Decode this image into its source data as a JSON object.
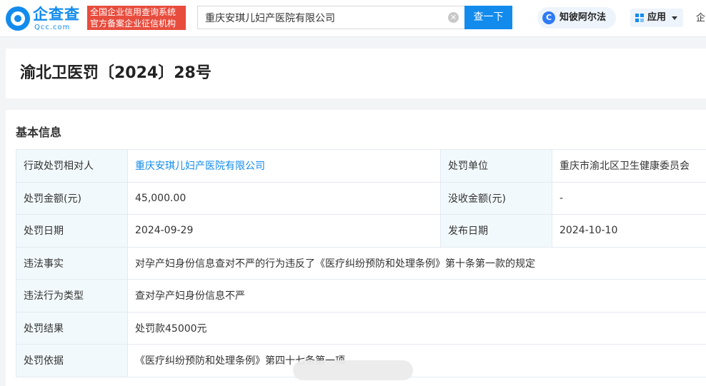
{
  "header": {
    "logo_cn": "企查查",
    "logo_en": "Qcc.com",
    "tagline_line1": "全国企业信用查询系统",
    "tagline_line2": "官方备案企业征信机构",
    "search_value": "重庆安琪儿妇产医院有限公司",
    "search_button": "查一下",
    "zhibi_icon_text": "C",
    "zhibi_label": "知彼阿尔法",
    "apps_label": "应用",
    "truncated_text": "企"
  },
  "page": {
    "title": "渝北卫医罚〔2024〕28号"
  },
  "basic_info": {
    "section_title": "基本信息",
    "rows": [
      {
        "label": "行政处罚相对人",
        "value": "重庆安琪儿妇产医院有限公司",
        "label2": "处罚单位",
        "value2": "重庆市渝北区卫生健康委员会"
      },
      {
        "label": "处罚金额(元)",
        "value": "45,000.00",
        "label2": "没收金额(元)",
        "value2": "-"
      },
      {
        "label": "处罚日期",
        "value": "2024-09-29",
        "label2": "发布日期",
        "value2": "2024-10-10"
      },
      {
        "label": "违法事实",
        "value": "对孕产妇身份信息查对不严的行为违反了《医疗纠纷预防和处理条例》第十条第一款的规定"
      },
      {
        "label": "违法行为类型",
        "value": "查对孕产妇身份信息不严"
      },
      {
        "label": "处罚结果",
        "value": "处罚款45000元"
      },
      {
        "label": "处罚依据",
        "value": "《医疗纠纷预防和处理条例》第四十七条第一项"
      }
    ]
  },
  "colors": {
    "brand_blue": "#128bed",
    "tagline_red": "#e84c3d",
    "label_bg": "#f2f9fc"
  }
}
